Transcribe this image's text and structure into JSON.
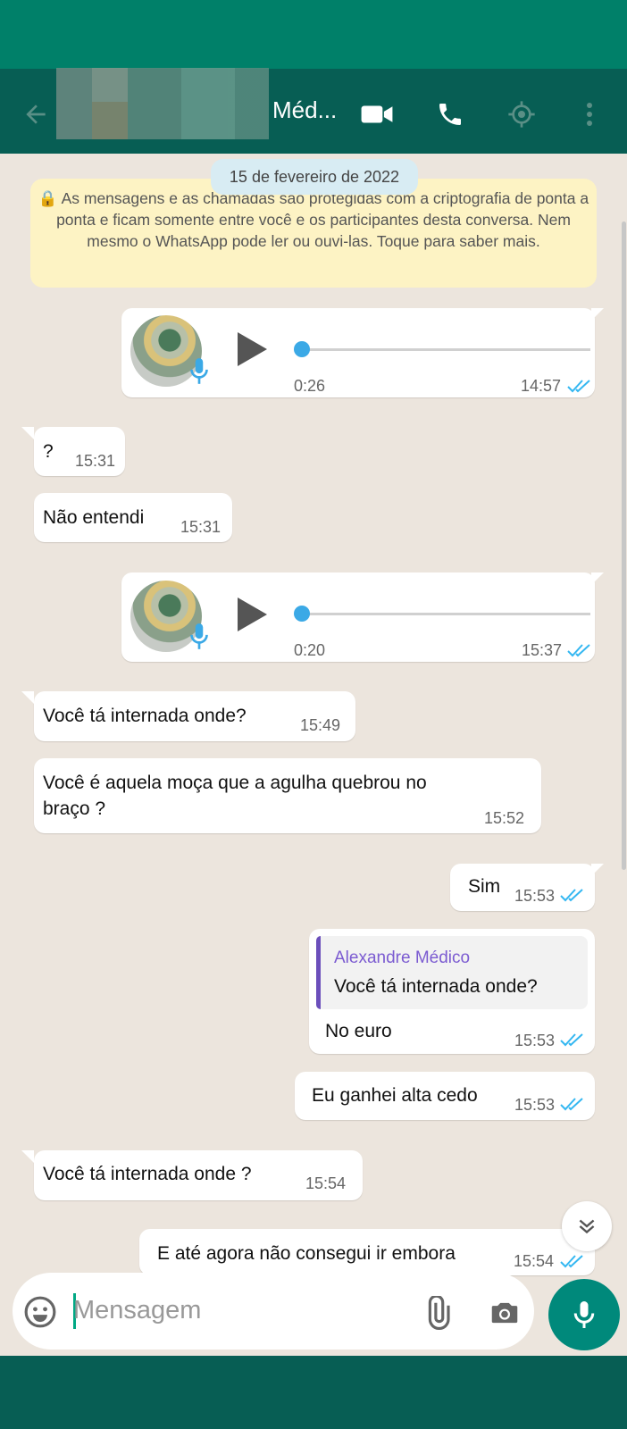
{
  "header": {
    "contact_name": "Méd...",
    "colors": {
      "status": "#008069",
      "appbar": "#075e54"
    },
    "icons": [
      "back-arrow-icon",
      "video-call-icon",
      "phone-call-icon",
      "location-icon",
      "more-vert-icon"
    ]
  },
  "chat": {
    "date": "15 de fevereiro de 2022",
    "encryption_notice": "🔒 As mensagens e as chamadas são protegidas com a criptografia de ponta a ponta e ficam somente entre você e os participantes desta conversa. Nem mesmo o WhatsApp pode ler ou ouvi-las. Toque para saber mais.",
    "messages": [
      {
        "type": "voice",
        "direction": "out",
        "duration": "0:26",
        "time": "14:57",
        "progress": 0
      },
      {
        "type": "text",
        "direction": "in",
        "text": "?",
        "time": "15:31"
      },
      {
        "type": "text",
        "direction": "in",
        "text": "Não entendi",
        "time": "15:31"
      },
      {
        "type": "voice",
        "direction": "out",
        "duration": "0:20",
        "time": "15:37",
        "progress": 0
      },
      {
        "type": "text",
        "direction": "in",
        "text": "Você tá internada onde?",
        "time": "15:49"
      },
      {
        "type": "text",
        "direction": "in",
        "text_line1": "Você é aquela moça que a agulha quebrou no",
        "text_line2": "braço ?",
        "time": "15:52"
      },
      {
        "type": "text",
        "direction": "out",
        "text": "Sim",
        "time": "15:53"
      },
      {
        "type": "reply",
        "direction": "out",
        "quoted_author": "Alexandre Médico",
        "quoted_text": "Você tá internada onde?",
        "text": "No euro",
        "time": "15:53"
      },
      {
        "type": "text",
        "direction": "out",
        "text": "Eu ganhei alta cedo",
        "time": "15:53"
      },
      {
        "type": "text",
        "direction": "in",
        "text": "Você tá internada onde ?",
        "time": "15:54"
      },
      {
        "type": "text",
        "direction": "out",
        "text": "E até agora não consegui ir embora",
        "time": "15:54"
      }
    ]
  },
  "composer": {
    "placeholder": "Mensagem",
    "icons": [
      "emoji-icon",
      "attach-icon",
      "camera-icon",
      "mic-icon"
    ]
  },
  "colors": {
    "read_ticks": "#34b7f1",
    "accent": "#00a884",
    "quote_bar": "#6b4fbb",
    "quote_author": "#7b5bd1"
  }
}
